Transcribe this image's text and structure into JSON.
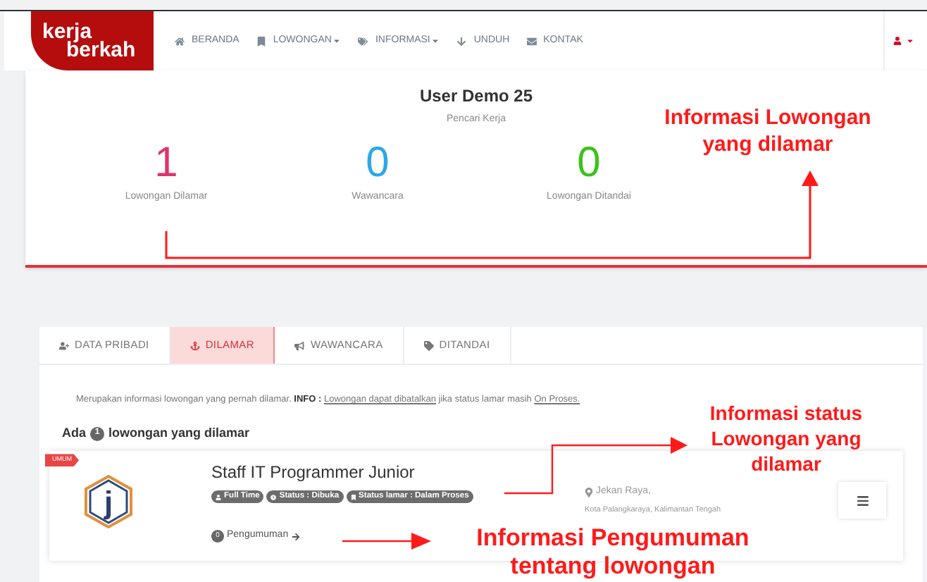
{
  "brand": {
    "line_1": "kerja",
    "line_2": "berkah"
  },
  "nav": [
    {
      "label": "BERANDA",
      "has_menu": false
    },
    {
      "label": "LOWONGAN",
      "has_menu": true
    },
    {
      "label": "INFORMASI",
      "has_menu": true
    },
    {
      "label": "UNDUH",
      "has_menu": false
    },
    {
      "label": "KONTAK",
      "has_menu": false
    }
  ],
  "profile": {
    "name": "User Demo 25",
    "role": "Pencari Kerja",
    "stats": [
      {
        "value": "1",
        "label": "Lowongan Dilamar",
        "color": "#e0336e"
      },
      {
        "value": "0",
        "label": "Wawancara",
        "color": "#2ba8e6"
      },
      {
        "value": "0",
        "label": "Lowongan Ditandai",
        "color": "#3cc21c"
      }
    ]
  },
  "tabs": [
    {
      "label": "DATA PRIBADI",
      "selected": false
    },
    {
      "label": "DILAMAR",
      "selected": true
    },
    {
      "label": "WAWANCARA",
      "selected": false
    },
    {
      "label": "DITANDAI",
      "selected": false
    }
  ],
  "info": {
    "text": "Merupakan informasi lowongan yang pernah dilamar.",
    "info_label": "INFO :",
    "link": "Lowongan dapat dibatalkan",
    "middle": "jika status lamar masih",
    "status_link": "On Proses."
  },
  "summary": {
    "prefix": "Ada",
    "count": "1",
    "suffix": "lowongan yang dilamar"
  },
  "jobs": [
    {
      "ribbon": "UMUM",
      "logo_letter": "j",
      "title": "Staff IT Programmer Junior",
      "badges": [
        {
          "label": "Full Time"
        },
        {
          "label": "Status : Dibuka"
        },
        {
          "label": "Status lamar : Dalam Proses"
        }
      ],
      "location_1": "Jekan Raya,",
      "location_2": "Kota Palangkaraya, Kalimantan Tengah",
      "announcement_count": "0",
      "announcement_label": "Pengumuman"
    }
  ],
  "annotations": [
    {
      "text": "Informasi Lowongan yang dilamar"
    },
    {
      "text": "Informasi status Lowongan yang dilamar"
    },
    {
      "text": "Informasi Pengumuman tentang lowongan"
    }
  ]
}
